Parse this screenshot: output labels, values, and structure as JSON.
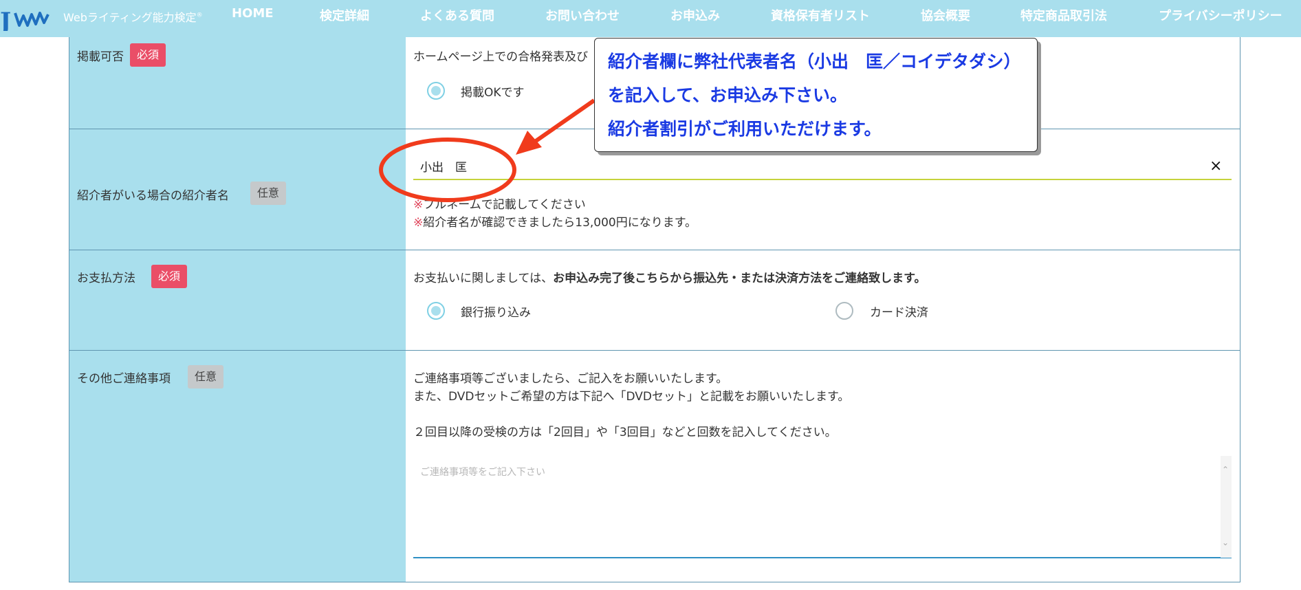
{
  "header": {
    "logo_text": "JWMA",
    "site_name": "Webライティング能力検定",
    "registered_mark": "®",
    "nav": [
      {
        "label": "HOME"
      },
      {
        "label": "検定詳細"
      },
      {
        "label": "よくある質問"
      },
      {
        "label": "お問い合わせ"
      },
      {
        "label": "お申込み"
      },
      {
        "label": "資格保有者リスト"
      },
      {
        "label": "協会概要"
      },
      {
        "label": "特定商品取引法"
      },
      {
        "label": "プライバシーポリシー"
      }
    ]
  },
  "form": {
    "publish": {
      "label": "掲載可否",
      "badge": "必須",
      "description": "ホームページ上での合格発表及び",
      "option_label": "掲載OKです",
      "option_selected": true
    },
    "referrer": {
      "label": "紹介者がいる場合の紹介者名",
      "badge": "任意",
      "value": "小出　匡",
      "clear_icon": "×",
      "note_mark": "※",
      "note1": "フルネームで記載してください",
      "note2": "紹介者名が確認できましたら13,000円になります。"
    },
    "payment": {
      "label": "お支払方法",
      "badge": "必須",
      "description_plain": "お支払いに関しましては、",
      "description_bold": "お申込み完了後こちらから振込先・または決済方法をご連絡致します。",
      "options": [
        {
          "label": "銀行振り込み",
          "selected": true
        },
        {
          "label": "カード決済",
          "selected": false
        }
      ]
    },
    "other": {
      "label": "その他ご連絡事項",
      "badge": "任意",
      "line1": "ご連絡事項等ございましたら、ご記入をお願いいたします。",
      "line2": "また、DVDセットご希望の方は下記へ「DVDセット」と記載をお願いいたします。",
      "line3": "２回目以降の受検の方は「2回目」や「3回目」などと回数を記入してください。",
      "placeholder": "ご連絡事項等をご記入下さい",
      "scroll_up": "⌃",
      "scroll_down": "⌄"
    }
  },
  "annotation": {
    "lines": [
      "紹介者欄に弊社代表者名（小出　匡／コイデタダシ）",
      "を記入して、お申込み下さい。",
      "紹介者割引がご利用いただけます。"
    ],
    "colors": {
      "text": "#1a3ae3",
      "ellipse": "#f03b1c",
      "arrow": "#f03b1c"
    }
  },
  "colors": {
    "nav_bg": "#a9dfed",
    "label_bg": "#a9dfed",
    "required": "#ea4e67",
    "optional": "#c5c9cb"
  }
}
